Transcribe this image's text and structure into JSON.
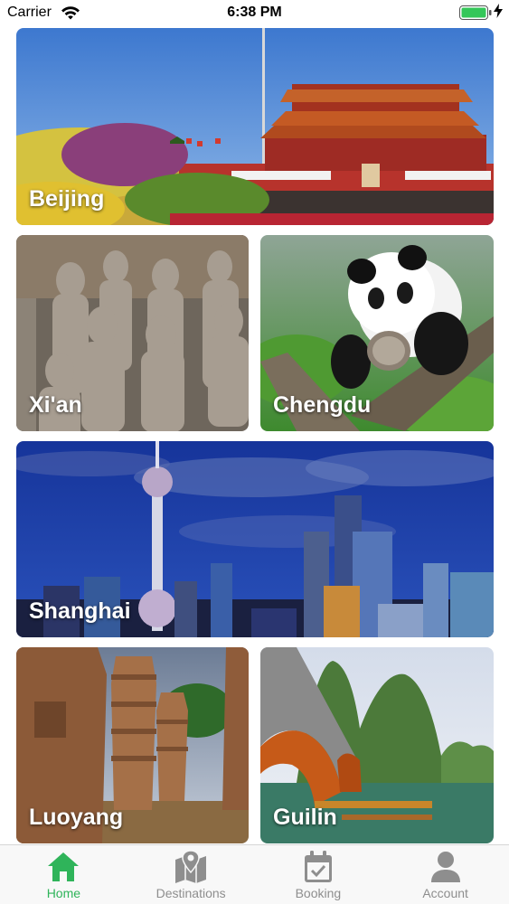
{
  "status_bar": {
    "carrier": "Carrier",
    "time": "6:38 PM",
    "battery_color": "#34c759"
  },
  "destinations": [
    {
      "name": "Beijing"
    },
    {
      "name": "Xi'an"
    },
    {
      "name": "Chengdu"
    },
    {
      "name": "Shanghai"
    },
    {
      "name": "Luoyang"
    },
    {
      "name": "Guilin"
    }
  ],
  "tab_bar": {
    "active_color": "#2fb45a",
    "inactive_color": "#8e8e8e",
    "tabs": [
      {
        "label": "Home",
        "icon": "home-icon",
        "active": true
      },
      {
        "label": "Destinations",
        "icon": "map-pin-icon",
        "active": false
      },
      {
        "label": "Booking",
        "icon": "calendar-check-icon",
        "active": false
      },
      {
        "label": "Account",
        "icon": "user-icon",
        "active": false
      }
    ]
  }
}
